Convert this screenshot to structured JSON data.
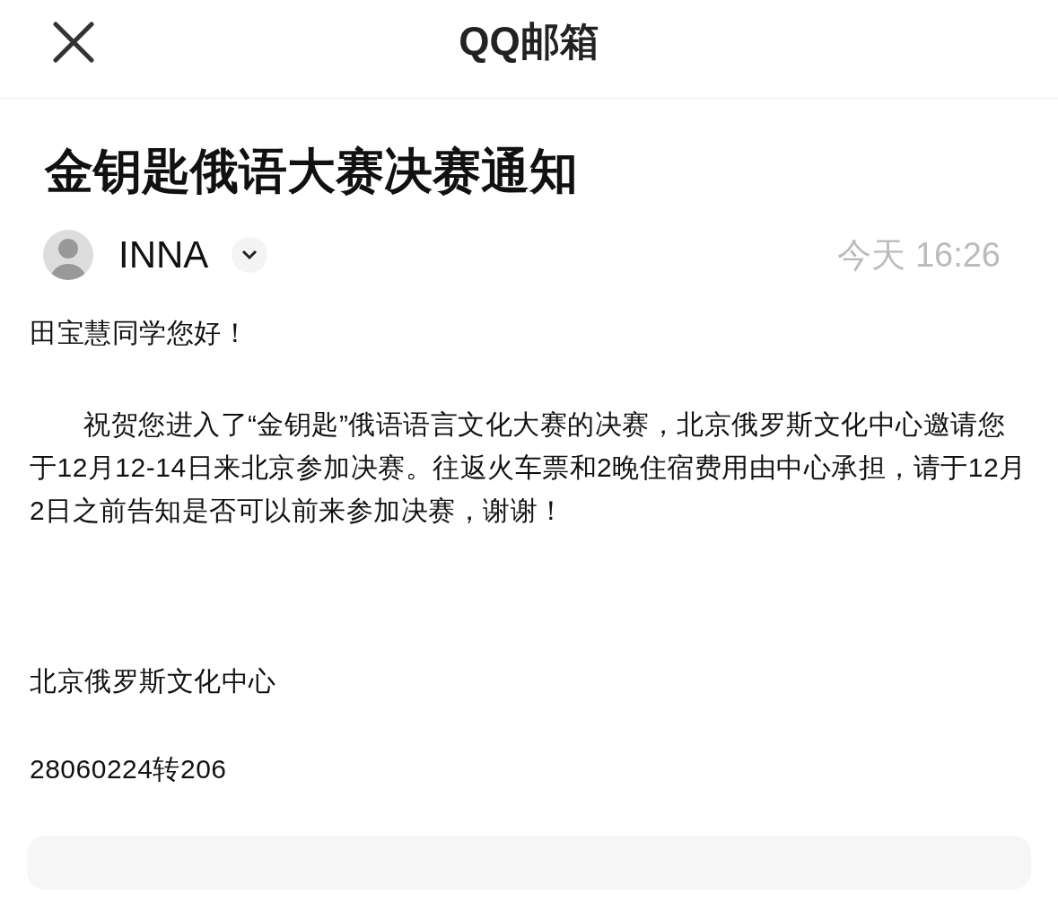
{
  "header": {
    "title": "QQ邮箱"
  },
  "mail": {
    "subject": "金钥匙俄语大赛决赛通知",
    "sender": "INNA",
    "time": "今天 16:26",
    "body": [
      {
        "kind": "greeting",
        "text": "田宝慧同学您好！"
      },
      {
        "kind": "indented",
        "text": "祝贺您进入了“金钥匙”俄语语言文化大赛的决赛，北京俄罗斯文化中心邀请您于12月12-14日来北京参加决赛。往返火车票和2晚住宿费用由中心承担，请于12月2日之前告知是否可以前来参加决赛，谢谢！"
      },
      {
        "kind": "signature",
        "text": "北京俄罗斯文化中心"
      },
      {
        "kind": "phone",
        "text": "28060224转206"
      }
    ]
  }
}
